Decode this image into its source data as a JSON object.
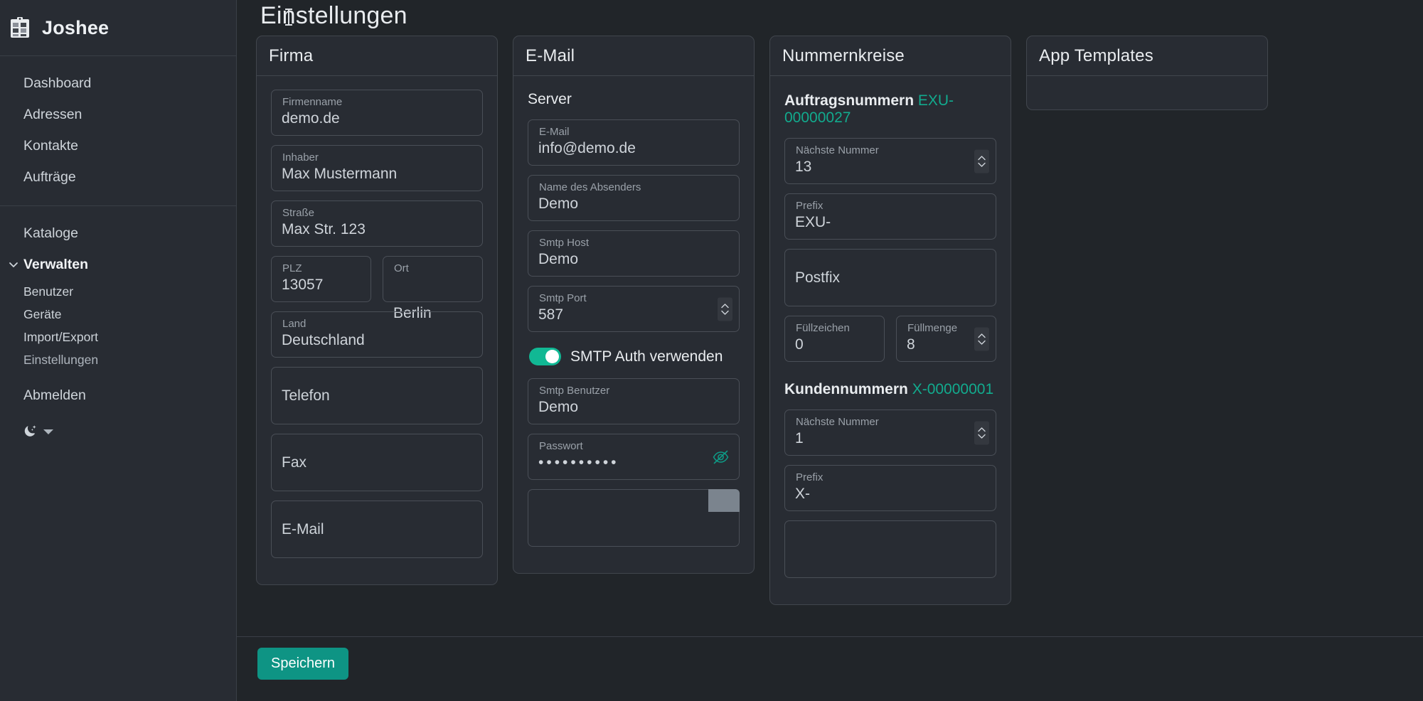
{
  "sidebar": {
    "brand": {
      "name": "Joshee",
      "icon": "clipboard-icon"
    },
    "primary_items": [
      {
        "label": "Dashboard"
      },
      {
        "label": "Adressen"
      },
      {
        "label": "Kontakte"
      },
      {
        "label": "Aufträge"
      }
    ],
    "secondary_items": [
      {
        "label": "Kataloge"
      }
    ],
    "group": {
      "label": "Verwalten",
      "chevron": "chevron-down-icon",
      "items": [
        {
          "label": "Benutzer"
        },
        {
          "label": "Geräte"
        },
        {
          "label": "Import/Export"
        },
        {
          "label": "Einstellungen"
        }
      ]
    },
    "logout": {
      "label": "Abmelden"
    },
    "theme": {
      "icon": "moon-stars-icon",
      "caret": "chevron-down-icon"
    }
  },
  "page": {
    "title": "Einstellungen"
  },
  "footer": {
    "save_label": "Speichern"
  },
  "cards": {
    "firma": {
      "title": "Firma",
      "fields": [
        {
          "label": "Firmenname",
          "value": "demo.de"
        },
        {
          "label": "Inhaber",
          "value": "Max Mustermann"
        },
        {
          "label": "Straße",
          "value": "Max Str. 123"
        },
        {
          "label": "PLZ",
          "value": "13057"
        },
        {
          "label": "Ort",
          "value": "Berlin"
        },
        {
          "label": "Land",
          "value": "Deutschland"
        },
        {
          "label": "Telefon",
          "value": ""
        },
        {
          "label": "Fax",
          "value": ""
        },
        {
          "label": "E-Mail",
          "value": ""
        }
      ]
    },
    "email": {
      "title": "E-Mail",
      "section": "Server",
      "fields": [
        {
          "label": "E-Mail",
          "value": "info@demo.de"
        },
        {
          "label": "Name des Absenders",
          "value": "Demo"
        },
        {
          "label": "Smtp Host",
          "value": "Demo"
        },
        {
          "label": "Smtp Port",
          "value": "587"
        }
      ],
      "toggle": {
        "label": "SMTP Auth verwenden",
        "state": "on"
      },
      "auth_fields": [
        {
          "label": "Smtp Benutzer",
          "value": "Demo"
        },
        {
          "label": "Passwort",
          "value": "••••••••••",
          "icon": "eye-off-icon"
        }
      ]
    },
    "nummernkreise": {
      "title": "Nummernkreise",
      "groups": [
        {
          "label": "Auftragsnummern",
          "preview": "EXU-00000027",
          "next_number": {
            "label": "Nächste Nummer",
            "value": "13"
          },
          "prefix": {
            "label": "Prefix",
            "value": "EXU-"
          },
          "postfix": {
            "label": "Postfix",
            "value": ""
          },
          "fill_char": {
            "label": "Füllzeichen",
            "value": "0"
          },
          "fill_amount": {
            "label": "Füllmenge",
            "value": "8"
          }
        },
        {
          "label": "Kundennummern",
          "preview": "X-00000001",
          "next_number": {
            "label": "Nächste Nummer",
            "value": "1"
          },
          "prefix": {
            "label": "Prefix",
            "value": "X-"
          }
        }
      ]
    },
    "app_templates": {
      "title": "App Templates"
    }
  },
  "colors": {
    "accent": "#12ab8e",
    "toggle_on": "#11b894",
    "save_button": "#0e9484",
    "background": "#212529",
    "card": "#282c33",
    "border": "#41464d"
  }
}
